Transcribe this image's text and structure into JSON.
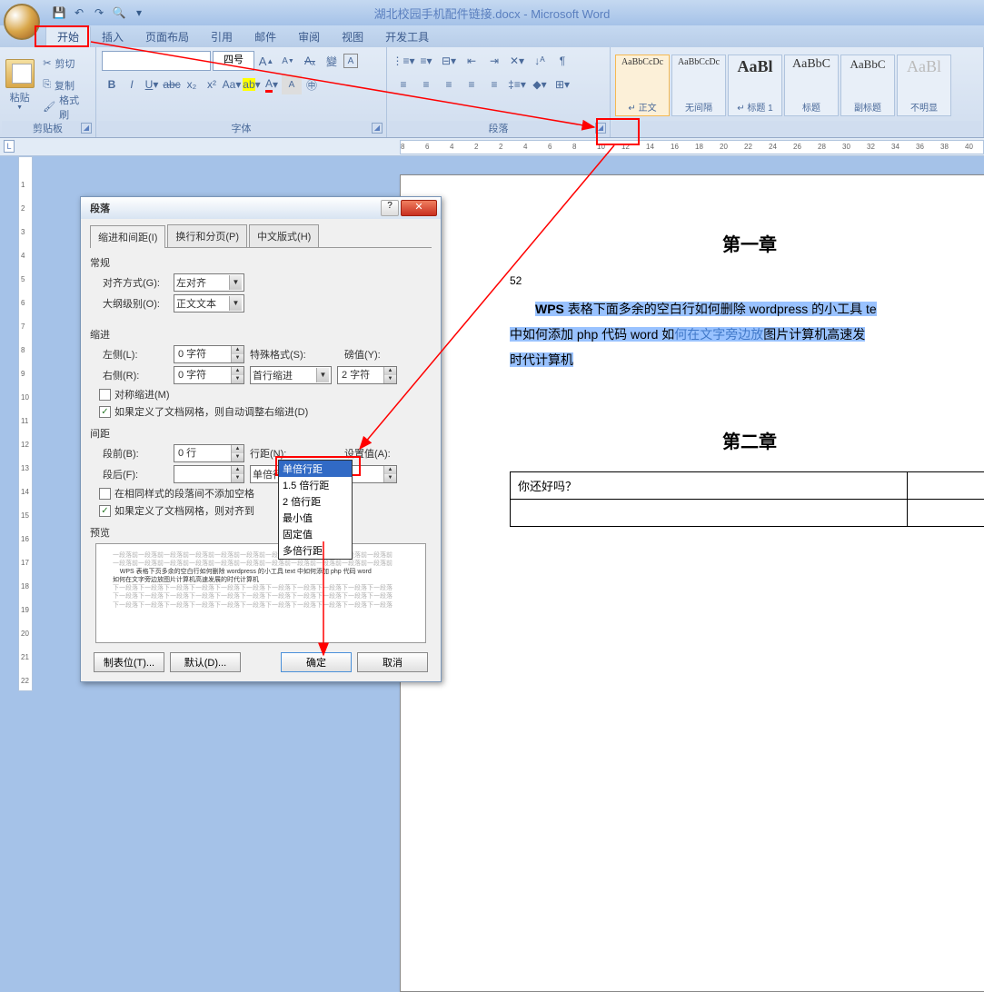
{
  "title": "湖北校园手机配件链接.docx - Microsoft Word",
  "tabs": [
    "开始",
    "插入",
    "页面布局",
    "引用",
    "邮件",
    "审阅",
    "视图",
    "开发工具"
  ],
  "clipboard": {
    "paste": "粘贴",
    "cut": "剪切",
    "copy": "复制",
    "format_painter": "格式刷",
    "group_label": "剪贴板"
  },
  "font": {
    "size_value": "四号",
    "group_label": "字体",
    "bold": "B",
    "italic": "I",
    "underline": "U",
    "strike": "abc",
    "aa_case": "Aa"
  },
  "paragraph": {
    "group_label": "段落"
  },
  "styles": [
    {
      "preview": "AaBbCcDc",
      "name": "↵ 正文",
      "size": "10px"
    },
    {
      "preview": "AaBbCcDc",
      "name": "无间隔",
      "size": "10px"
    },
    {
      "preview": "AaBl",
      "name": "↵ 标题 1",
      "size": "18px",
      "bold": true
    },
    {
      "preview": "AaBbC",
      "name": "标题",
      "size": "14px"
    },
    {
      "preview": "AaBbC",
      "name": "副标题",
      "size": "13px"
    },
    {
      "preview": "AaBl",
      "name": "不明显",
      "size": "18px",
      "light": true
    }
  ],
  "doc": {
    "chapter1": "第一章",
    "pagenum": "52",
    "line1_a": "WPS 表格下面多余的空白行如何删除 wordpress 的小工具 te",
    "line2_a": "中如何添加 php 代码 word 如",
    "line2_link": "何在文字旁边放",
    "line2_b": "图片计算机高速发",
    "line3": "时代计算机",
    "chapter2": "第二章",
    "table_cell": "你还好吗？"
  },
  "dialog": {
    "title": "段落",
    "tabs": [
      "缩进和间距(I)",
      "换行和分页(P)",
      "中文版式(H)"
    ],
    "general": "常规",
    "alignment_lbl": "对齐方式(G):",
    "alignment_val": "左对齐",
    "outline_lbl": "大纲级别(O):",
    "outline_val": "正文文本",
    "indent": "缩进",
    "left_lbl": "左侧(L):",
    "left_val": "0 字符",
    "right_lbl": "右侧(R):",
    "right_val": "0 字符",
    "special_lbl": "特殊格式(S):",
    "special_val": "首行缩进",
    "by_lbl": "磅值(Y):",
    "by_val": "2 字符",
    "mirror": "对称缩进(M)",
    "auto_adjust_right": "如果定义了文档网格，则自动调整右缩进(D)",
    "spacing": "间距",
    "before_lbl": "段前(B):",
    "before_val": "0 行",
    "after_lbl": "段后(F):",
    "line_spacing_lbl": "行距(N):",
    "line_spacing_val": "单倍行距",
    "at_lbl": "设置值(A):",
    "no_space_same": "在相同样式的段落间不添加空格",
    "snap_grid": "如果定义了文档网格，则对齐到",
    "preview": "预览",
    "preview_text1": "WPS 表格下页多余的空白行如何删除 wordpress 的小工具 text 中如何添加 php 代码 word",
    "preview_text2": "如何在文字旁边放图片计算机高速发展的时代计算机",
    "btn_tabs": "制表位(T)...",
    "btn_default": "默认(D)...",
    "btn_ok": "确定",
    "btn_cancel": "取消"
  },
  "dropdown": {
    "items": [
      "单倍行距",
      "1.5 倍行距",
      "2 倍行距",
      "最小值",
      "固定值",
      "多倍行距"
    ]
  },
  "ruler_marks": [
    8,
    6,
    4,
    2,
    2,
    4,
    6,
    8,
    10,
    12,
    14,
    16,
    18,
    20,
    22,
    24,
    26,
    28,
    30,
    32,
    34,
    36,
    38,
    40
  ]
}
